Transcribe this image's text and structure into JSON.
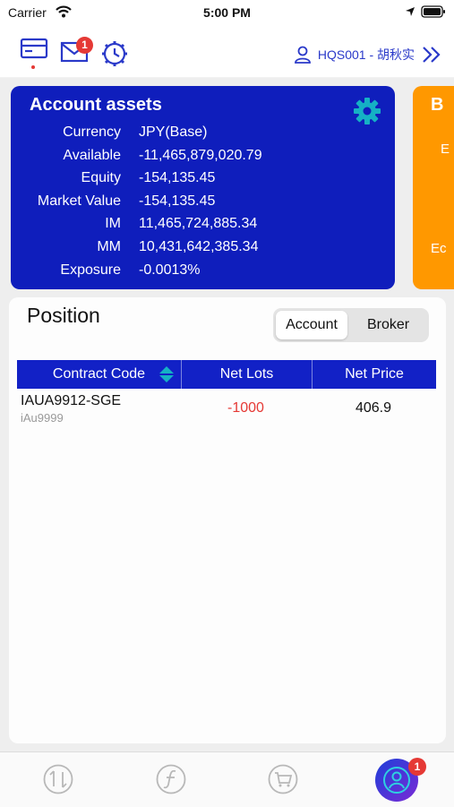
{
  "status_bar": {
    "carrier": "Carrier",
    "time": "5:00 PM"
  },
  "toolbar": {
    "mail_badge": "1",
    "user_label": "HQS001 - 胡秋实"
  },
  "assets": {
    "title": "Account assets",
    "rows": [
      {
        "label": "Currency",
        "value": "JPY(Base)"
      },
      {
        "label": "Available",
        "value": "-11,465,879,020.79"
      },
      {
        "label": "Equity",
        "value": "-154,135.45"
      },
      {
        "label": "Market Value",
        "value": "-154,135.45"
      },
      {
        "label": "IM",
        "value": "11,465,724,885.34"
      },
      {
        "label": "MM",
        "value": "10,431,642,385.34"
      },
      {
        "label": "Exposure",
        "value": "-0.0013%"
      }
    ]
  },
  "next_card": {
    "title": "B",
    "line1": "E",
    "line2": "Ec"
  },
  "position": {
    "title": "Position",
    "tabs": {
      "account": "Account",
      "broker": "Broker"
    },
    "columns": {
      "code": "Contract Code",
      "lots": "Net Lots",
      "price": "Net Price"
    },
    "rows": [
      {
        "code": "IAUA9912-SGE",
        "sub": "iAu9999",
        "lots": "-1000",
        "price": "406.9"
      }
    ]
  },
  "tabbar": {
    "badge": "1"
  },
  "colors": {
    "primary": "#0f1ebc",
    "header_blue": "#1221c6",
    "orange": "#ff9800",
    "teal": "#15b1c4",
    "negative": "#e53935",
    "badge": "#e53935"
  },
  "icons": [
    "wifi-icon",
    "location-icon",
    "battery-icon",
    "card-icon",
    "mail-icon",
    "clock-gear-icon",
    "user-icon",
    "double-chevron-right-icon",
    "gear-icon",
    "sort-icon",
    "transfer-icon",
    "function-icon",
    "cart-icon",
    "profile-icon"
  ]
}
